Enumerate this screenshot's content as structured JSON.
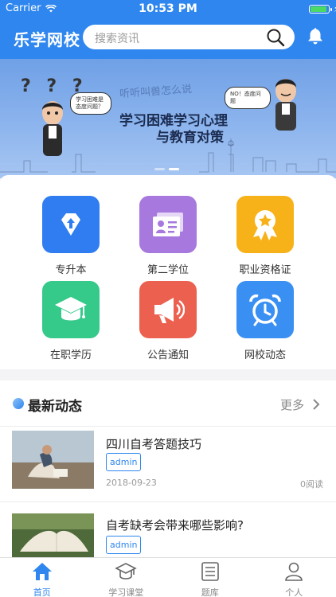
{
  "status": {
    "carrier": "Carrier",
    "time": "10:53 PM",
    "battery_level": 0.9
  },
  "header": {
    "brand": "乐学网校",
    "search_placeholder": "搜索资讯"
  },
  "banner": {
    "ghost_text": "听听叫兽怎么说",
    "title_line1": "学习困难学习心理",
    "title_line2": "与教育对策",
    "bubble_left": "学习困难是态度问题？",
    "bubble_right": "NO！态度问题",
    "qmarks": "? ? ?",
    "active_slide": 1
  },
  "colors": {
    "primary": "#2e86ee",
    "icon_blue": "#2f7df0",
    "icon_purple": "#a778de",
    "icon_yellow": "#f7b21a",
    "icon_green": "#35c98a",
    "icon_red": "#ec6050",
    "icon_lightblue": "#3a8ff3"
  },
  "grid": [
    {
      "label": "专升本",
      "icon": "upgrade-diamond-icon"
    },
    {
      "label": "第二学位",
      "icon": "id-card-icon"
    },
    {
      "label": "职业资格证",
      "icon": "award-badge-icon"
    },
    {
      "label": "在职学历",
      "icon": "graduation-cap-icon"
    },
    {
      "label": "公告通知",
      "icon": "megaphone-icon"
    },
    {
      "label": "网校动态",
      "icon": "alarm-clock-icon"
    }
  ],
  "news": {
    "title": "最新动态",
    "more": "更多",
    "articles": [
      {
        "title": "四川自考答题技巧",
        "tag": "admin",
        "date": "2018-09-23",
        "reads": "0阅读"
      },
      {
        "title": "自考缺考会带来哪些影响?",
        "tag": "admin"
      }
    ]
  },
  "tabs": [
    {
      "label": "首页",
      "icon": "home-icon",
      "active": true
    },
    {
      "label": "学习课堂",
      "icon": "mortarboard-icon",
      "active": false
    },
    {
      "label": "题库",
      "icon": "question-bank-icon",
      "active": false
    },
    {
      "label": "个人",
      "icon": "user-icon",
      "active": false
    }
  ]
}
